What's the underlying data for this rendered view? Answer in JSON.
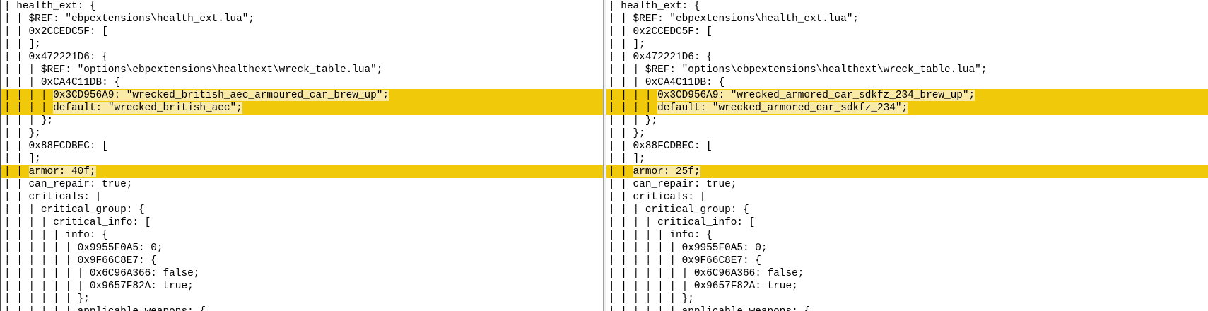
{
  "colors": {
    "changed_line": "#f0ca0a",
    "changed_segment": "#faeaa8",
    "text": "#000000",
    "background": "#ffffff"
  },
  "left": {
    "lines": [
      {
        "changed": false,
        "segs": [
          {
            "t": "| health_ext: {",
            "hl": false
          }
        ]
      },
      {
        "changed": false,
        "segs": [
          {
            "t": "| | $REF: \"ebpextensions\\health_ext.lua\";",
            "hl": false
          }
        ]
      },
      {
        "changed": false,
        "segs": [
          {
            "t": "| | 0x2CCEDC5F: [",
            "hl": false
          }
        ]
      },
      {
        "changed": false,
        "segs": [
          {
            "t": "| | ];",
            "hl": false
          }
        ]
      },
      {
        "changed": false,
        "segs": [
          {
            "t": "| | 0x472221D6: {",
            "hl": false
          }
        ]
      },
      {
        "changed": false,
        "segs": [
          {
            "t": "| | | $REF: \"options\\ebpextensions\\healthext\\wreck_table.lua\";",
            "hl": false
          }
        ]
      },
      {
        "changed": false,
        "segs": [
          {
            "t": "| | | 0xCA4C11DB: {",
            "hl": false
          }
        ]
      },
      {
        "changed": true,
        "segs": [
          {
            "t": "| | | | ",
            "hl": false
          },
          {
            "t": "0x3CD956A9: ",
            "hl": true
          },
          {
            "t": "\"wrecked_british_aec_armoured_car_brew_up\";",
            "hl": true
          }
        ]
      },
      {
        "changed": true,
        "segs": [
          {
            "t": "| | | | ",
            "hl": false
          },
          {
            "t": "default: ",
            "hl": true
          },
          {
            "t": "\"wrecked_british_aec\";",
            "hl": true
          }
        ]
      },
      {
        "changed": false,
        "segs": [
          {
            "t": "| | | };",
            "hl": false
          }
        ]
      },
      {
        "changed": false,
        "segs": [
          {
            "t": "| | };",
            "hl": false
          }
        ]
      },
      {
        "changed": false,
        "segs": [
          {
            "t": "| | 0x88FCDBEC: [",
            "hl": false
          }
        ]
      },
      {
        "changed": false,
        "segs": [
          {
            "t": "| | ];",
            "hl": false
          }
        ]
      },
      {
        "changed": true,
        "segs": [
          {
            "t": "| | ",
            "hl": false
          },
          {
            "t": "armor: ",
            "hl": true
          },
          {
            "t": "40f;",
            "hl": true
          }
        ]
      },
      {
        "changed": false,
        "segs": [
          {
            "t": "| | can_repair: true;",
            "hl": false
          }
        ]
      },
      {
        "changed": false,
        "segs": [
          {
            "t": "| | criticals: [",
            "hl": false
          }
        ]
      },
      {
        "changed": false,
        "segs": [
          {
            "t": "| | | critical_group: {",
            "hl": false
          }
        ]
      },
      {
        "changed": false,
        "segs": [
          {
            "t": "| | | | critical_info: [",
            "hl": false
          }
        ]
      },
      {
        "changed": false,
        "segs": [
          {
            "t": "| | | | | info: {",
            "hl": false
          }
        ]
      },
      {
        "changed": false,
        "segs": [
          {
            "t": "| | | | | | 0x9955F0A5: 0;",
            "hl": false
          }
        ]
      },
      {
        "changed": false,
        "segs": [
          {
            "t": "| | | | | | 0x9F66C8E7: {",
            "hl": false
          }
        ]
      },
      {
        "changed": false,
        "segs": [
          {
            "t": "| | | | | | | 0x6C96A366: false;",
            "hl": false
          }
        ]
      },
      {
        "changed": false,
        "segs": [
          {
            "t": "| | | | | | | 0x9657F82A: true;",
            "hl": false
          }
        ]
      },
      {
        "changed": false,
        "segs": [
          {
            "t": "| | | | | | };",
            "hl": false
          }
        ]
      },
      {
        "changed": false,
        "segs": [
          {
            "t": "| | | | | | applicable_weapons: {",
            "hl": false
          }
        ]
      }
    ]
  },
  "right": {
    "lines": [
      {
        "changed": false,
        "segs": [
          {
            "t": "| health_ext: {",
            "hl": false
          }
        ]
      },
      {
        "changed": false,
        "segs": [
          {
            "t": "| | $REF: \"ebpextensions\\health_ext.lua\";",
            "hl": false
          }
        ]
      },
      {
        "changed": false,
        "segs": [
          {
            "t": "| | 0x2CCEDC5F: [",
            "hl": false
          }
        ]
      },
      {
        "changed": false,
        "segs": [
          {
            "t": "| | ];",
            "hl": false
          }
        ]
      },
      {
        "changed": false,
        "segs": [
          {
            "t": "| | 0x472221D6: {",
            "hl": false
          }
        ]
      },
      {
        "changed": false,
        "segs": [
          {
            "t": "| | | $REF: \"options\\ebpextensions\\healthext\\wreck_table.lua\";",
            "hl": false
          }
        ]
      },
      {
        "changed": false,
        "segs": [
          {
            "t": "| | | 0xCA4C11DB: {",
            "hl": false
          }
        ]
      },
      {
        "changed": true,
        "segs": [
          {
            "t": "| | | | ",
            "hl": false
          },
          {
            "t": "0x3CD956A9: ",
            "hl": true
          },
          {
            "t": "\"wrecked_armored_car_sdkfz_234_brew_up\";",
            "hl": true
          }
        ]
      },
      {
        "changed": true,
        "segs": [
          {
            "t": "| | | | ",
            "hl": false
          },
          {
            "t": "default: ",
            "hl": true
          },
          {
            "t": "\"wrecked_armored_car_sdkfz_234\";",
            "hl": true
          }
        ]
      },
      {
        "changed": false,
        "segs": [
          {
            "t": "| | | };",
            "hl": false
          }
        ]
      },
      {
        "changed": false,
        "segs": [
          {
            "t": "| | };",
            "hl": false
          }
        ]
      },
      {
        "changed": false,
        "segs": [
          {
            "t": "| | 0x88FCDBEC: [",
            "hl": false
          }
        ]
      },
      {
        "changed": false,
        "segs": [
          {
            "t": "| | ];",
            "hl": false
          }
        ]
      },
      {
        "changed": true,
        "segs": [
          {
            "t": "| | ",
            "hl": false
          },
          {
            "t": "armor: ",
            "hl": true
          },
          {
            "t": "25f;",
            "hl": true
          }
        ]
      },
      {
        "changed": false,
        "segs": [
          {
            "t": "| | can_repair: true;",
            "hl": false
          }
        ]
      },
      {
        "changed": false,
        "segs": [
          {
            "t": "| | criticals: [",
            "hl": false
          }
        ]
      },
      {
        "changed": false,
        "segs": [
          {
            "t": "| | | critical_group: {",
            "hl": false
          }
        ]
      },
      {
        "changed": false,
        "segs": [
          {
            "t": "| | | | critical_info: [",
            "hl": false
          }
        ]
      },
      {
        "changed": false,
        "segs": [
          {
            "t": "| | | | | info: {",
            "hl": false
          }
        ]
      },
      {
        "changed": false,
        "segs": [
          {
            "t": "| | | | | | 0x9955F0A5: 0;",
            "hl": false
          }
        ]
      },
      {
        "changed": false,
        "segs": [
          {
            "t": "| | | | | | 0x9F66C8E7: {",
            "hl": false
          }
        ]
      },
      {
        "changed": false,
        "segs": [
          {
            "t": "| | | | | | | 0x6C96A366: false;",
            "hl": false
          }
        ]
      },
      {
        "changed": false,
        "segs": [
          {
            "t": "| | | | | | | 0x9657F82A: true;",
            "hl": false
          }
        ]
      },
      {
        "changed": false,
        "segs": [
          {
            "t": "| | | | | | };",
            "hl": false
          }
        ]
      },
      {
        "changed": false,
        "segs": [
          {
            "t": "| | | | | | applicable_weapons: {",
            "hl": false
          }
        ]
      }
    ]
  }
}
